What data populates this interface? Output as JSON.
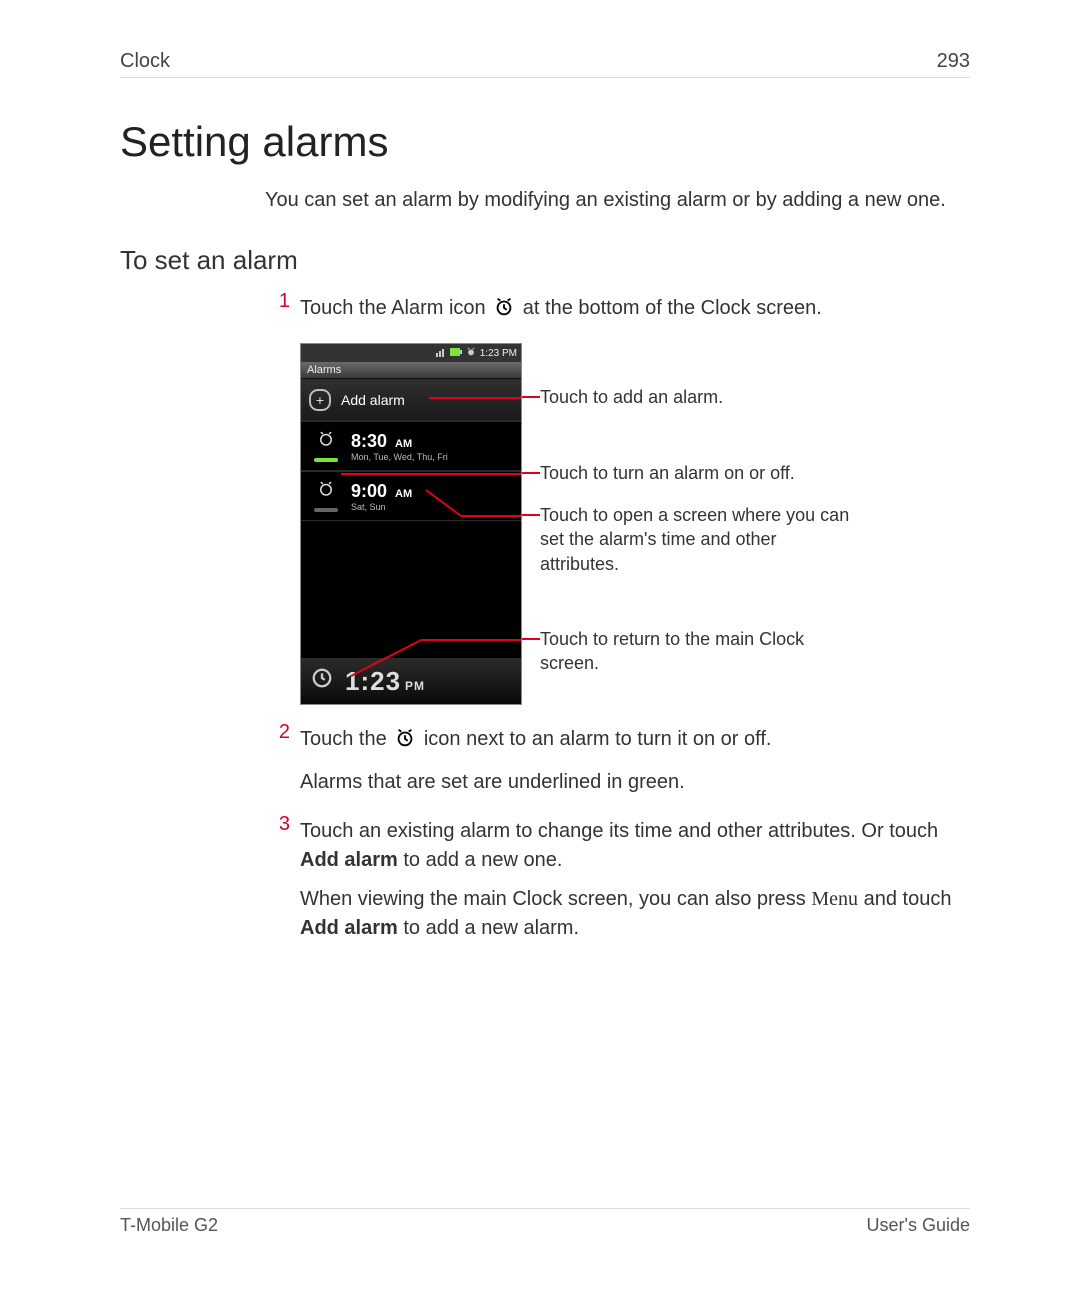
{
  "header": {
    "section": "Clock",
    "page_number": "293"
  },
  "title": "Setting alarms",
  "intro": "You can set an alarm by modifying an existing alarm or by adding a new one.",
  "subhead": "To set an alarm",
  "steps": {
    "s1_num": "1",
    "s1_a": "Touch the Alarm icon ",
    "s1_b": " at the bottom of the Clock screen.",
    "s2_num": "2",
    "s2_a": "Touch the ",
    "s2_b": " icon next to an alarm to turn it on or off.",
    "s2_line2": "Alarms that are set are underlined in green.",
    "s3_num": "3",
    "s3_a": "Touch an existing alarm to change its time and other attributes. Or touch ",
    "s3_bold": "Add alarm",
    "s3_b": " to add a new one.",
    "s3_p2_a": "When viewing the main Clock screen, you can also press ",
    "s3_menu": "Menu",
    "s3_p2_b": " and touch ",
    "s3_p2_bold": "Add alarm",
    "s3_p2_c": " to add a new alarm."
  },
  "phone": {
    "status_time": "1:23 PM",
    "tab": "Alarms",
    "add_label": "Add alarm",
    "alarm1_time": "8:30",
    "alarm1_ampm": "AM",
    "alarm1_days": "Mon, Tue, Wed, Thu, Fri",
    "alarm2_time": "9:00",
    "alarm2_ampm": "AM",
    "alarm2_days": "Sat, Sun",
    "footer_time": "1:23",
    "footer_ampm": "PM"
  },
  "callouts": {
    "c1": "Touch to add an alarm.",
    "c2": "Touch to turn an alarm on or off.",
    "c3": "Touch to open a screen where you can set the alarm's time and other attributes.",
    "c4": "Touch to return to the main Clock screen."
  },
  "footer": {
    "left": "T-Mobile G2",
    "right": "User's Guide"
  }
}
